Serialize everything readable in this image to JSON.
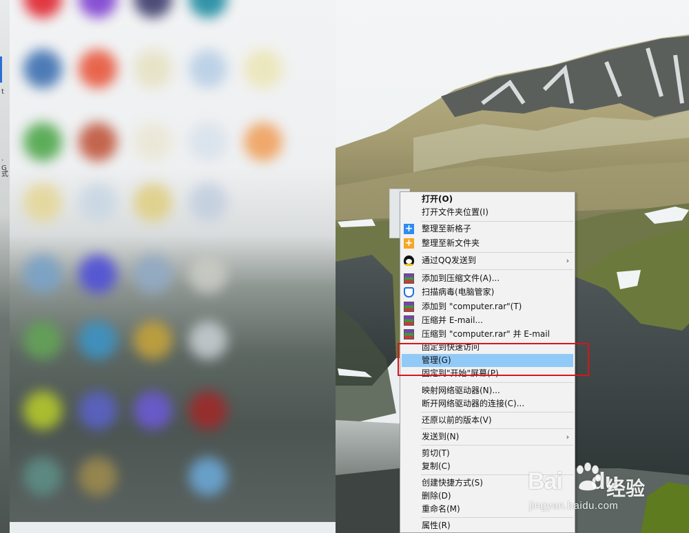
{
  "menu": {
    "items": [
      {
        "label": "打开(O)",
        "bold": true,
        "icon": "",
        "submenu": false
      },
      {
        "label": "打开文件夹位置(I)",
        "icon": "",
        "submenu": false
      },
      {
        "label": "整理至新格子",
        "icon": "plus-blue-icon",
        "submenu": false
      },
      {
        "label": "整理至新文件夹",
        "icon": "plus-orange-icon",
        "submenu": false
      },
      {
        "label": "通过QQ发送到",
        "icon": "qq-penguin-icon",
        "submenu": true
      },
      {
        "label": "添加到压缩文件(A)...",
        "icon": "winrar-icon",
        "submenu": false
      },
      {
        "label": "扫描病毒(电脑管家)",
        "icon": "shield-icon",
        "submenu": false
      },
      {
        "label": "添加到 \"computer.rar\"(T)",
        "icon": "winrar-icon",
        "submenu": false
      },
      {
        "label": "压缩并 E-mail...",
        "icon": "winrar-icon",
        "submenu": false
      },
      {
        "label": "压缩到 \"computer.rar\" 并 E-mail",
        "icon": "winrar-icon",
        "submenu": false
      },
      {
        "label": "固定到快速访问",
        "icon": "",
        "submenu": false
      },
      {
        "label": "管理(G)",
        "icon": "",
        "submenu": false,
        "highlighted": true
      },
      {
        "label": "固定到\"开始\"屏幕(P)",
        "icon": "",
        "submenu": false
      },
      {
        "label": "映射网络驱动器(N)...",
        "icon": "",
        "submenu": false
      },
      {
        "label": "断开网络驱动器的连接(C)...",
        "icon": "",
        "submenu": false
      },
      {
        "label": "还原以前的版本(V)",
        "icon": "",
        "submenu": false
      },
      {
        "label": "发送到(N)",
        "icon": "",
        "submenu": true
      },
      {
        "label": "剪切(T)",
        "icon": "",
        "submenu": false
      },
      {
        "label": "复制(C)",
        "icon": "",
        "submenu": false
      },
      {
        "label": "创建快捷方式(S)",
        "icon": "",
        "submenu": false
      },
      {
        "label": "删除(D)",
        "icon": "",
        "submenu": false
      },
      {
        "label": "重命名(M)",
        "icon": "",
        "submenu": false
      },
      {
        "label": "属性(R)",
        "icon": "",
        "submenu": false
      }
    ],
    "submenu_arrow": "›",
    "highlight_color": "#91c9f7"
  },
  "annotation": {
    "color": "#d9141b"
  },
  "left_strip": {
    "fragment_1": "t",
    "fragment_2": "· G",
    "fragment_3": "式"
  },
  "watermark": {
    "brand_latin": "Bai",
    "brand_latin_2": "du",
    "brand_cn": "经验",
    "url": "jingyan.baidu.com"
  }
}
